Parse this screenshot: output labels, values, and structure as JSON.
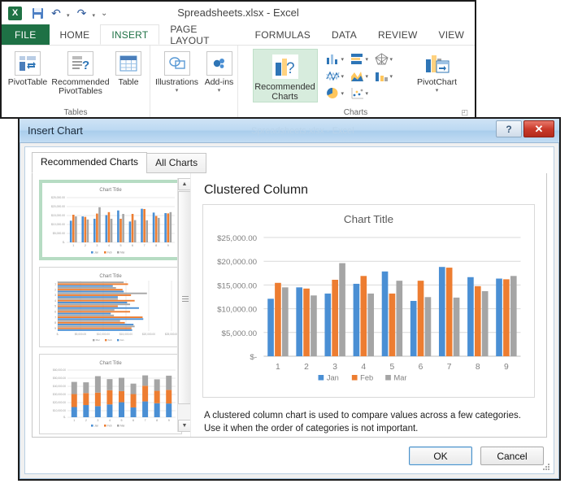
{
  "excel": {
    "title": "Spreadsheets.xlsx - Excel",
    "logo": "excel-logo",
    "qat": {
      "save": "save-icon",
      "undo": "undo-icon",
      "redo": "redo-icon",
      "customize": "customize-qat-icon"
    },
    "ribbon_tabs": [
      {
        "label": "FILE",
        "active": false
      },
      {
        "label": "HOME",
        "active": false
      },
      {
        "label": "INSERT",
        "active": true
      },
      {
        "label": "PAGE LAYOUT",
        "active": false
      },
      {
        "label": "FORMULAS",
        "active": false
      },
      {
        "label": "DATA",
        "active": false
      },
      {
        "label": "REVIEW",
        "active": false
      },
      {
        "label": "VIEW",
        "active": false
      }
    ],
    "groups": [
      {
        "name": "Tables",
        "items": [
          {
            "label": "PivotTable",
            "icon": "pivottable-icon"
          },
          {
            "label": "Recommended PivotTables",
            "icon": "recommended-pivottables-icon"
          },
          {
            "label": "Table",
            "icon": "table-icon"
          }
        ]
      },
      {
        "name": "",
        "items": [
          {
            "label": "Illustrations",
            "icon": "illustrations-icon",
            "dropdown": "▾"
          },
          {
            "label": "Add-ins",
            "icon": "addins-icon",
            "dropdown": "▾"
          }
        ]
      },
      {
        "name": "Charts",
        "items": [
          {
            "label": "Recommended Charts",
            "icon": "recommended-charts-icon"
          },
          {
            "label": "PivotChart",
            "icon": "pivotchart-icon",
            "dropdown": "▾"
          }
        ],
        "chart_type_icons": [
          "column-chart-icon",
          "bar-chart-icon",
          "radar-chart-icon",
          "line-chart-icon",
          "area-chart-icon",
          "combo-chart-icon",
          "pie-chart-icon",
          "scatter-chart-icon"
        ],
        "dialog_launcher": "dialog-launcher-icon"
      }
    ]
  },
  "dialog": {
    "title": "Insert Chart",
    "ghost_title": "Spreadsheets.xlsx - Excel",
    "help_label": "?",
    "close_label": "✕",
    "tabs": [
      {
        "label": "Recommended Charts",
        "active": true
      },
      {
        "label": "All Charts",
        "active": false
      }
    ],
    "thumbnails": [
      {
        "name": "clustered-column",
        "selected": true
      },
      {
        "name": "clustered-bar",
        "selected": false
      },
      {
        "name": "stacked-column",
        "selected": false
      }
    ],
    "preview_title": "Clustered Column",
    "description": "A clustered column chart is used to compare values across a few categories. Use it when the order of categories is not important.",
    "buttons": {
      "ok": "OK",
      "cancel": "Cancel"
    },
    "scrollbar": {
      "up": "▲",
      "down": "▼"
    }
  },
  "chart_data": {
    "type": "bar",
    "title": "Chart Title",
    "xlabel": "",
    "ylabel": "",
    "categories": [
      "1",
      "2",
      "3",
      "4",
      "5",
      "6",
      "7",
      "8",
      "9"
    ],
    "series": [
      {
        "name": "Jan",
        "color": "#4a8fd4",
        "values": [
          12100,
          14500,
          13200,
          15250,
          17850,
          11650,
          18800,
          16650,
          16350
        ]
      },
      {
        "name": "Feb",
        "color": "#ed7d31",
        "values": [
          15450,
          14250,
          16100,
          16900,
          13200,
          15900,
          18650,
          14750,
          16200
        ]
      },
      {
        "name": "Mar",
        "color": "#a5a5a5",
        "values": [
          14500,
          12800,
          19600,
          13200,
          15900,
          12450,
          12350,
          13700,
          16900
        ]
      }
    ],
    "ylim": [
      0,
      25000
    ],
    "yticks": [
      0,
      5000,
      10000,
      15000,
      20000,
      25000
    ],
    "ytick_labels": [
      "$-",
      "$5,000.00",
      "$10,000.00",
      "$15,000.00",
      "$20,000.00",
      "$25,000.00"
    ],
    "grid": true,
    "legend_position": "bottom",
    "legend": [
      "Jan",
      "Feb",
      "Mar"
    ]
  }
}
